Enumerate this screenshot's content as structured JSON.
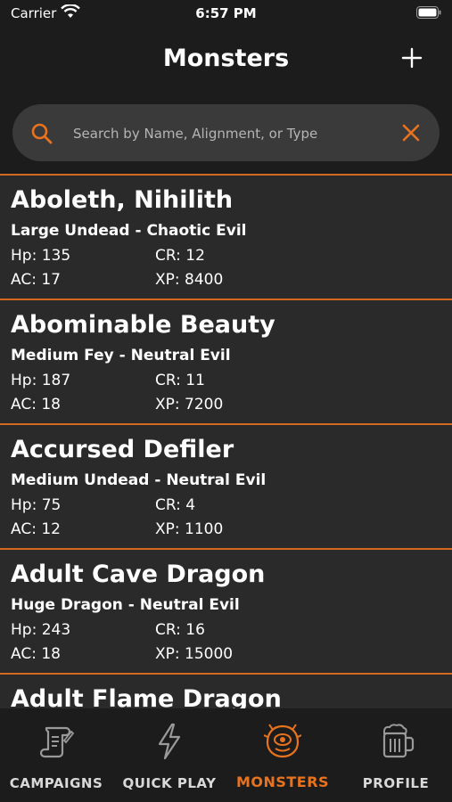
{
  "status": {
    "carrier": "Carrier",
    "time": "6:57 PM"
  },
  "header": {
    "title": "Monsters"
  },
  "search": {
    "placeholder": "Search by Name, Alignment, or Type",
    "value": ""
  },
  "monsters": [
    {
      "name": "Aboleth, Nihilith",
      "type": "Large Undead - Chaotic Evil",
      "hp": "Hp: 135",
      "cr": "CR: 12",
      "ac": "AC: 17",
      "xp": "XP: 8400"
    },
    {
      "name": "Abominable Beauty",
      "type": "Medium Fey - Neutral Evil",
      "hp": "Hp: 187",
      "cr": "CR: 11",
      "ac": "AC: 18",
      "xp": "XP: 7200"
    },
    {
      "name": "Accursed Defiler",
      "type": "Medium Undead - Neutral Evil",
      "hp": "Hp: 75",
      "cr": "CR: 4",
      "ac": "AC: 12",
      "xp": "XP: 1100"
    },
    {
      "name": "Adult Cave Dragon",
      "type": "Huge Dragon - Neutral Evil",
      "hp": "Hp: 243",
      "cr": "CR: 16",
      "ac": "AC: 18",
      "xp": "XP: 15000"
    },
    {
      "name": "Adult Flame Dragon",
      "type": "",
      "hp": "",
      "cr": "",
      "ac": "",
      "xp": ""
    }
  ],
  "tabs": [
    {
      "label": "CAMPAIGNS",
      "icon": "scroll-icon"
    },
    {
      "label": "QUICK PLAY",
      "icon": "lightning-icon"
    },
    {
      "label": "MONSTERS",
      "icon": "monster-eye-icon"
    },
    {
      "label": "PROFILE",
      "icon": "beer-mug-icon"
    }
  ],
  "colors": {
    "accent": "#e8731e",
    "background": "#1c1c1c",
    "card": "#2b2a2a",
    "search_bg": "#3a3a3a"
  }
}
